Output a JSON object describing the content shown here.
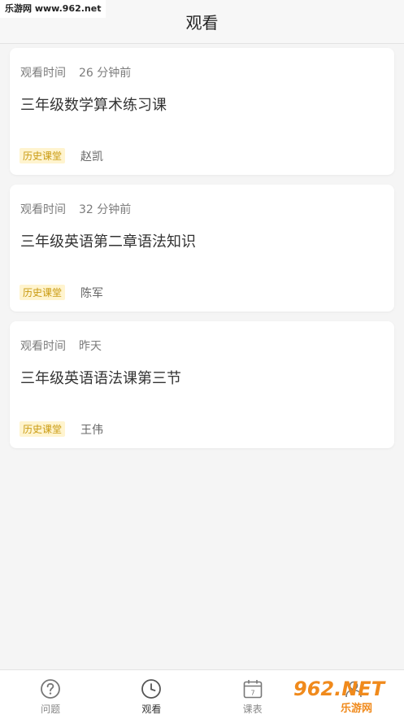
{
  "watermark_top": "乐游网 www.962.net",
  "header": {
    "title": "观看"
  },
  "cards": [
    {
      "meta_label": "观看时间",
      "time": "26 分钟前",
      "title": "三年级数学算术练习课",
      "tag": "历史课堂",
      "teacher": "赵凯"
    },
    {
      "meta_label": "观看时间",
      "time": "32 分钟前",
      "title": "三年级英语第二章语法知识",
      "tag": "历史课堂",
      "teacher": "陈军"
    },
    {
      "meta_label": "观看时间",
      "time": "昨天",
      "title": "三年级英语语法课第三节",
      "tag": "历史课堂",
      "teacher": "王伟"
    }
  ],
  "tabbar": {
    "tabs": [
      {
        "label": "问题",
        "icon": "question-circle-icon"
      },
      {
        "label": "观看",
        "icon": "clock-icon",
        "active": true
      },
      {
        "label": "课表",
        "icon": "calendar-icon"
      },
      {
        "label": "",
        "icon": "profile-icon"
      }
    ],
    "calendar_day": "7"
  },
  "watermark_br": {
    "brand": "962.NET",
    "sub": "乐游网"
  },
  "colors": {
    "tag_bg": "#fff4cf",
    "tag_text": "#c99a10",
    "watermark_orange": "#f08a1c"
  }
}
